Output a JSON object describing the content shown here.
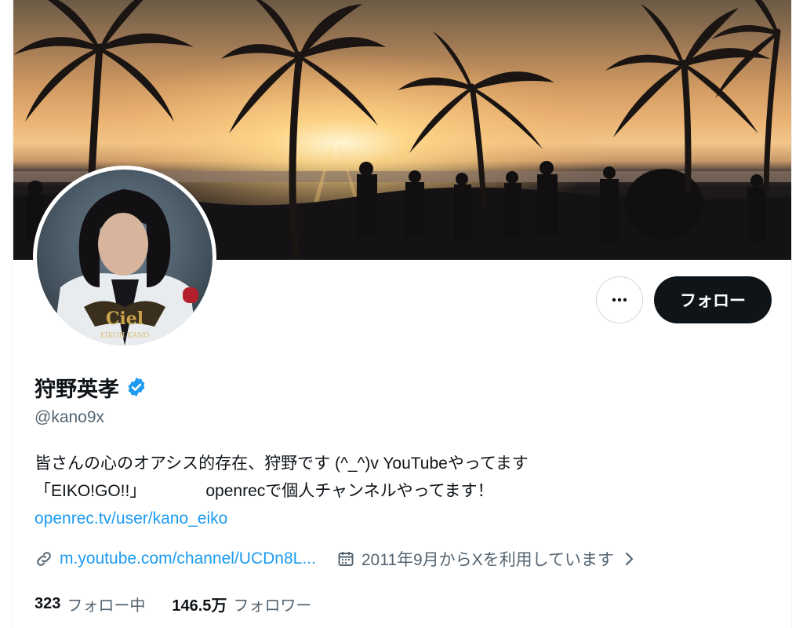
{
  "profile": {
    "display_name": "狩野英孝",
    "verified": true,
    "handle": "@kano9x",
    "bio_line1": "皆さんの心のオアシス的存在、狩野です (^_^)v YouTubeやってます",
    "bio_line2a": "「EIKO!GO!!」",
    "bio_line2b": "openrecで個人チャンネルやってます！",
    "bio_link": "openrec.tv/user/kano_eiko",
    "avatar_logo_text": "Ciel",
    "avatar_caption": "EIKOH KANO"
  },
  "actions": {
    "more_icon": "more-horizontal-icon",
    "follow_label": "フォロー"
  },
  "meta": {
    "link_icon": "link-icon",
    "website": "m.youtube.com/channel/UCDn8L...",
    "calendar_icon": "calendar-icon",
    "joined": "2011年9月からXを利用しています",
    "chevron_icon": "chevron-right-icon"
  },
  "stats": {
    "following_count": "323",
    "following_label": "フォロー中",
    "followers_count": "146.5万",
    "followers_label": "フォロワー"
  },
  "colors": {
    "accent": "#1d9bf0",
    "text_primary": "#0f1419",
    "text_secondary": "#536471",
    "follow_button_bg": "#0f1419",
    "border": "#cfd9de"
  }
}
